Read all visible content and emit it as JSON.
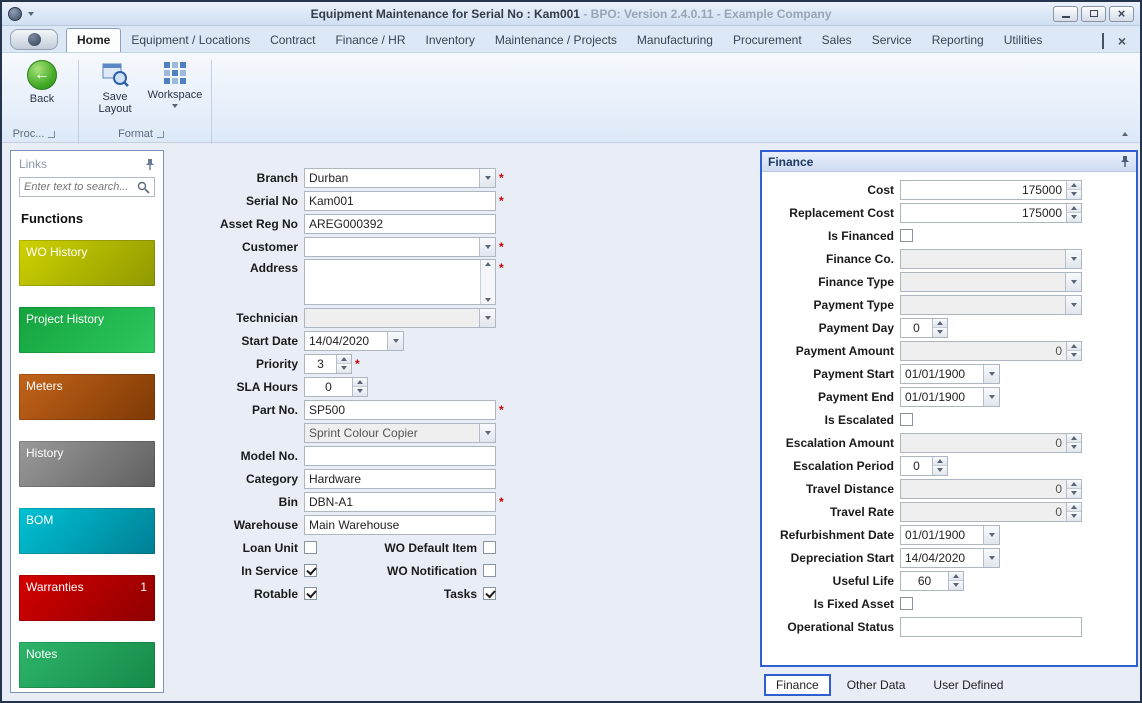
{
  "window": {
    "title": "Equipment Maintenance for Serial No : Kam001",
    "subtitle": " - BPO: Version 2.4.0.11 - Example Company"
  },
  "colors": {
    "highlight_blue": "#2f5fd0",
    "required_red": "#cc0000"
  },
  "icons": {
    "app": "sphere",
    "quick_access_dropdown": "chevron-down",
    "minimize": "bar",
    "maximize": "square",
    "close": "x",
    "back": "left-arrow-circle",
    "save_layout": "window-magnifier",
    "workspace": "grid",
    "search": "magnifier",
    "pin": "push-pin",
    "dropdown": "chevron-down",
    "spin_up": "triangle-up",
    "spin_down": "triangle-down",
    "collapse_ribbon": "chevron-up",
    "dialog_launcher": "corner-box"
  },
  "ribbon": {
    "tabs": [
      {
        "label": "Home",
        "active": true
      },
      {
        "label": "Equipment / Locations"
      },
      {
        "label": "Contract"
      },
      {
        "label": "Finance / HR"
      },
      {
        "label": "Inventory"
      },
      {
        "label": "Maintenance / Projects"
      },
      {
        "label": "Manufacturing"
      },
      {
        "label": "Procurement"
      },
      {
        "label": "Sales"
      },
      {
        "label": "Service"
      },
      {
        "label": "Reporting"
      },
      {
        "label": "Utilities"
      }
    ],
    "buttons": {
      "back": "Back",
      "save_layout": "Save Layout",
      "workspace": "Workspace"
    },
    "groups": [
      {
        "label": "Proc..."
      },
      {
        "label": "Format"
      }
    ]
  },
  "sidebar": {
    "title": "Links",
    "search_placeholder": "Enter text to search...",
    "heading": "Functions",
    "items": [
      {
        "label": "WO History",
        "c1": "#cfd200",
        "c2": "#8f9900"
      },
      {
        "label": "Project History",
        "c1": "#13a33e",
        "c2": "#2fc85e"
      },
      {
        "label": "Meters",
        "c1": "#c3631a",
        "c2": "#7e3a05"
      },
      {
        "label": "History",
        "c1": "#9a9a9a",
        "c2": "#5f5f5f"
      },
      {
        "label": "BOM",
        "c1": "#00c2d4",
        "c2": "#007f95"
      },
      {
        "label": "Warranties",
        "c1": "#d40000",
        "c2": "#8f0000",
        "badge": "1"
      },
      {
        "label": "Notes",
        "c1": "#2db56a",
        "c2": "#168a48"
      }
    ]
  },
  "form": {
    "branch": {
      "label": "Branch",
      "value": "Durban",
      "required": true
    },
    "serial_no": {
      "label": "Serial No",
      "value": "Kam001",
      "required": true
    },
    "asset_reg_no": {
      "label": "Asset Reg No",
      "value": "AREG000392"
    },
    "customer": {
      "label": "Customer",
      "value": "",
      "required": true
    },
    "address": {
      "label": "Address",
      "value": "",
      "required": true
    },
    "technician": {
      "label": "Technician",
      "value": ""
    },
    "start_date": {
      "label": "Start Date",
      "value": "14/04/2020"
    },
    "priority": {
      "label": "Priority",
      "value": "3",
      "required": true
    },
    "sla_hours": {
      "label": "SLA Hours",
      "value": "0"
    },
    "part_no": {
      "label": "Part No.",
      "value": "SP500",
      "required": true
    },
    "part_desc": {
      "value": "Sprint Colour Copier"
    },
    "model_no": {
      "label": "Model No.",
      "value": ""
    },
    "category": {
      "label": "Category",
      "value": "Hardware"
    },
    "bin": {
      "label": "Bin",
      "value": "DBN-A1",
      "required": true
    },
    "warehouse": {
      "label": "Warehouse",
      "value": "Main Warehouse"
    },
    "checks": {
      "loan_unit": {
        "label": "Loan Unit",
        "checked": false
      },
      "wo_default_item": {
        "label": "WO Default Item",
        "checked": false
      },
      "in_service": {
        "label": "In Service",
        "checked": true
      },
      "wo_notification": {
        "label": "WO Notification",
        "checked": false
      },
      "rotable": {
        "label": "Rotable",
        "checked": true
      },
      "tasks": {
        "label": "Tasks",
        "checked": true
      }
    }
  },
  "finance": {
    "title": "Finance",
    "cost": {
      "label": "Cost",
      "value": "175000"
    },
    "replacement_cost": {
      "label": "Replacement Cost",
      "value": "175000"
    },
    "is_financed": {
      "label": "Is Financed",
      "checked": false
    },
    "finance_co": {
      "label": "Finance Co.",
      "value": ""
    },
    "finance_type": {
      "label": "Finance Type",
      "value": ""
    },
    "payment_type": {
      "label": "Payment Type",
      "value": ""
    },
    "payment_day": {
      "label": "Payment Day",
      "value": "0"
    },
    "payment_amount": {
      "label": "Payment Amount",
      "value": "0"
    },
    "payment_start": {
      "label": "Payment Start",
      "value": "01/01/1900"
    },
    "payment_end": {
      "label": "Payment End",
      "value": "01/01/1900"
    },
    "is_escalated": {
      "label": "Is Escalated",
      "checked": false
    },
    "escalation_amount": {
      "label": "Escalation Amount",
      "value": "0"
    },
    "escalation_period": {
      "label": "Escalation Period",
      "value": "0"
    },
    "travel_distance": {
      "label": "Travel Distance",
      "value": "0"
    },
    "travel_rate": {
      "label": "Travel Rate",
      "value": "0"
    },
    "refurbishment_date": {
      "label": "Refurbishment Date",
      "value": "01/01/1900"
    },
    "depreciation_start": {
      "label": "Depreciation Start",
      "value": "14/04/2020"
    },
    "useful_life": {
      "label": "Useful Life",
      "value": "60"
    },
    "is_fixed_asset": {
      "label": "Is Fixed Asset",
      "checked": false
    },
    "operational_status": {
      "label": "Operational Status",
      "value": ""
    },
    "tabs": [
      {
        "label": "Finance",
        "active": true
      },
      {
        "label": "Other Data"
      },
      {
        "label": "User Defined"
      }
    ]
  }
}
